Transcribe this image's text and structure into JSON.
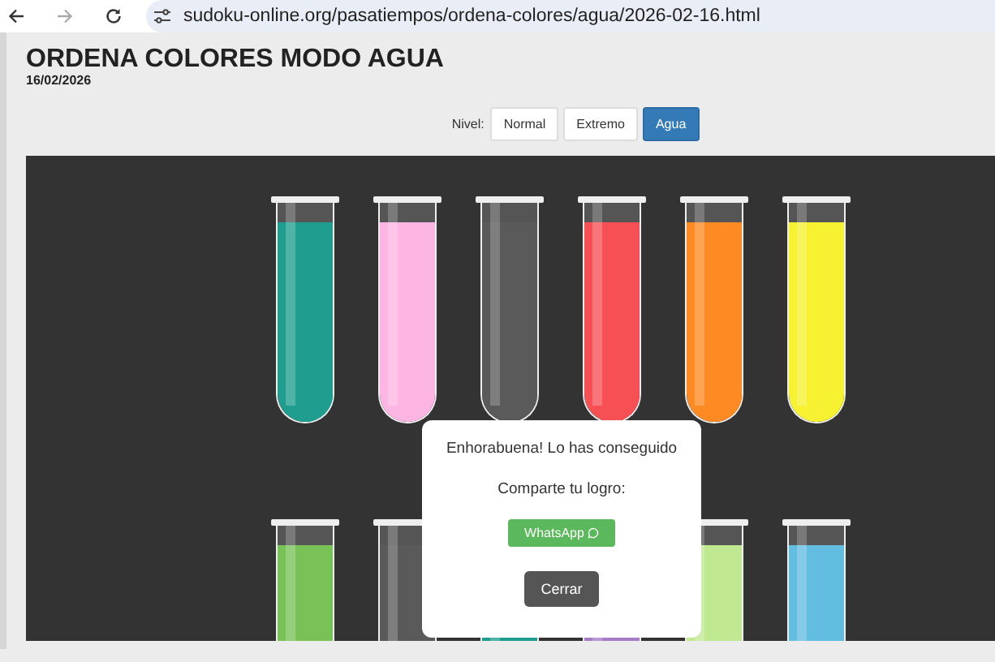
{
  "browser": {
    "url": "sudoku-online.org/pasatiempos/ordena-colores/agua/2026-02-16.html"
  },
  "page": {
    "title": "ORDENA COLORES MODO AGUA",
    "date": "16/02/2026"
  },
  "levels": {
    "label": "Nivel:",
    "options": [
      {
        "label": "Normal",
        "selected": false
      },
      {
        "label": "Extremo",
        "selected": false
      },
      {
        "label": "Agua",
        "selected": true
      }
    ]
  },
  "tube_rows": [
    {
      "tubes": [
        {
          "color": "#1f9e8f"
        },
        {
          "color": "#fdb5e3"
        },
        {
          "color": "#5a5a5a"
        },
        {
          "color": "#f65054"
        },
        {
          "color": "#fd8a22"
        },
        {
          "color": "#f6f131"
        }
      ]
    },
    {
      "tubes": [
        {
          "color": "#78c257"
        },
        {
          "color": "#5a5a5a"
        },
        {
          "color": "#1f9e8f"
        },
        {
          "color": "#a67cc8"
        },
        {
          "color": "#c0e890"
        },
        {
          "color": "#63bde0"
        }
      ]
    }
  ],
  "dialog": {
    "message": "Enhorabuena! Lo has conseguido",
    "share_label": "Comparte tu logro:",
    "share_button": "WhatsApp",
    "close_button": "Cerrar"
  }
}
